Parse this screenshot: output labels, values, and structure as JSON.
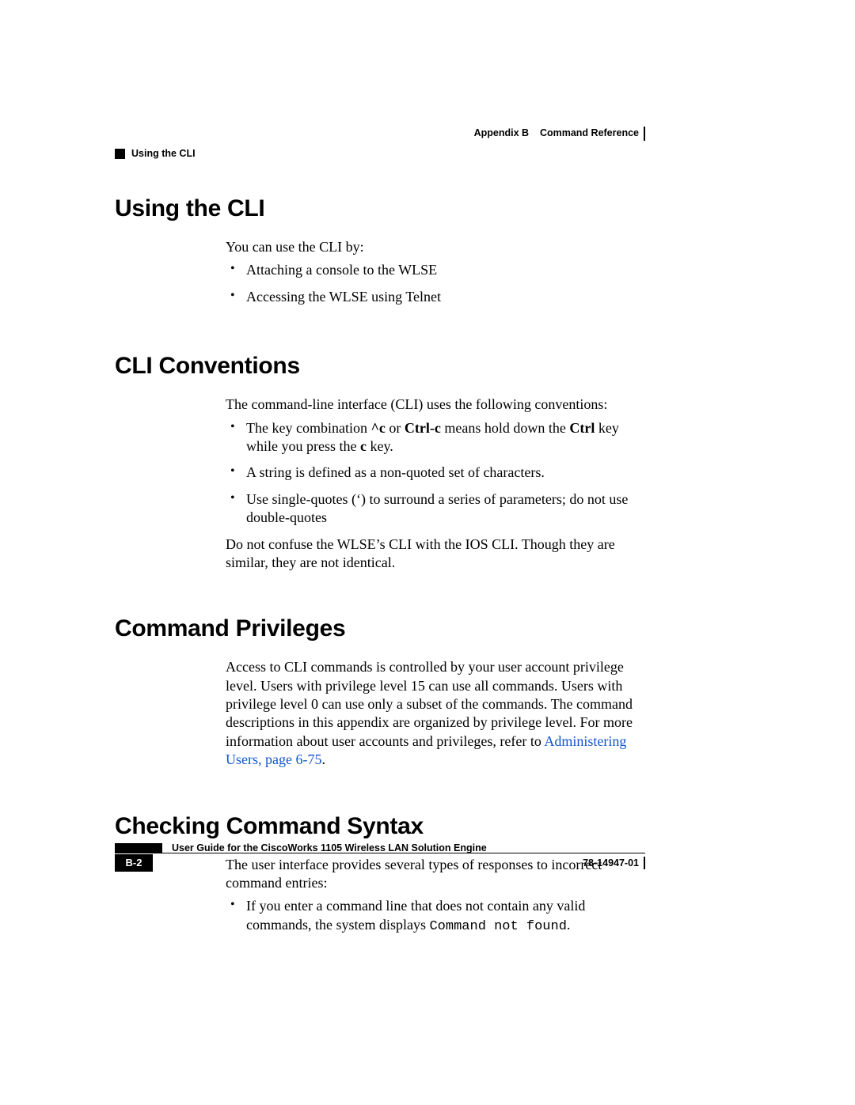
{
  "header": {
    "appendix": "Appendix B",
    "appendix_title": "Command Reference",
    "section_crumb": "Using the CLI"
  },
  "sections": {
    "using_cli": {
      "title": "Using the CLI",
      "intro": "You can use the CLI by:",
      "bullets": [
        "Attaching a console to the WLSE",
        "Accessing the WLSE using Telnet"
      ]
    },
    "conventions": {
      "title": "CLI Conventions",
      "intro": "The command-line interface (CLI) uses the following conventions:",
      "bullet1_pre": "The key combination ",
      "bullet1_b1": "^c",
      "bullet1_mid1": " or ",
      "bullet1_b2": "Ctrl-c",
      "bullet1_mid2": " means hold down the ",
      "bullet1_b3": "Ctrl",
      "bullet1_mid3": " key while you press the ",
      "bullet1_b4": "c",
      "bullet1_post": " key.",
      "bullet2": "A string is defined as a non-quoted set of characters.",
      "bullet3": "Use single-quotes (‘) to surround a series of parameters; do not use double-quotes",
      "trailer": "Do not confuse the WLSE’s CLI with the IOS CLI. Though they are similar, they are not identical."
    },
    "privileges": {
      "title": "Command Privileges",
      "para_pre": "Access to CLI commands is controlled by your user account privilege level. Users with privilege level 15 can use all commands. Users with privilege level 0 can use only a subset of the commands. The command descriptions in this appendix are organized by privilege level. For more information about user accounts and privileges, refer to ",
      "link_text": "Administering Users, page 6-75",
      "para_post": "."
    },
    "syntax": {
      "title": "Checking Command Syntax",
      "intro": "The user interface provides several types of responses to incorrect command entries:",
      "bullet1_pre": "If you enter a command line that does not contain any valid commands, the system displays ",
      "bullet1_code": "Command not found",
      "bullet1_post": "."
    }
  },
  "footer": {
    "guide_title": "User Guide for the CiscoWorks 1105 Wireless LAN Solution Engine",
    "page_number": "B-2",
    "doc_number": "78-14947-01"
  }
}
